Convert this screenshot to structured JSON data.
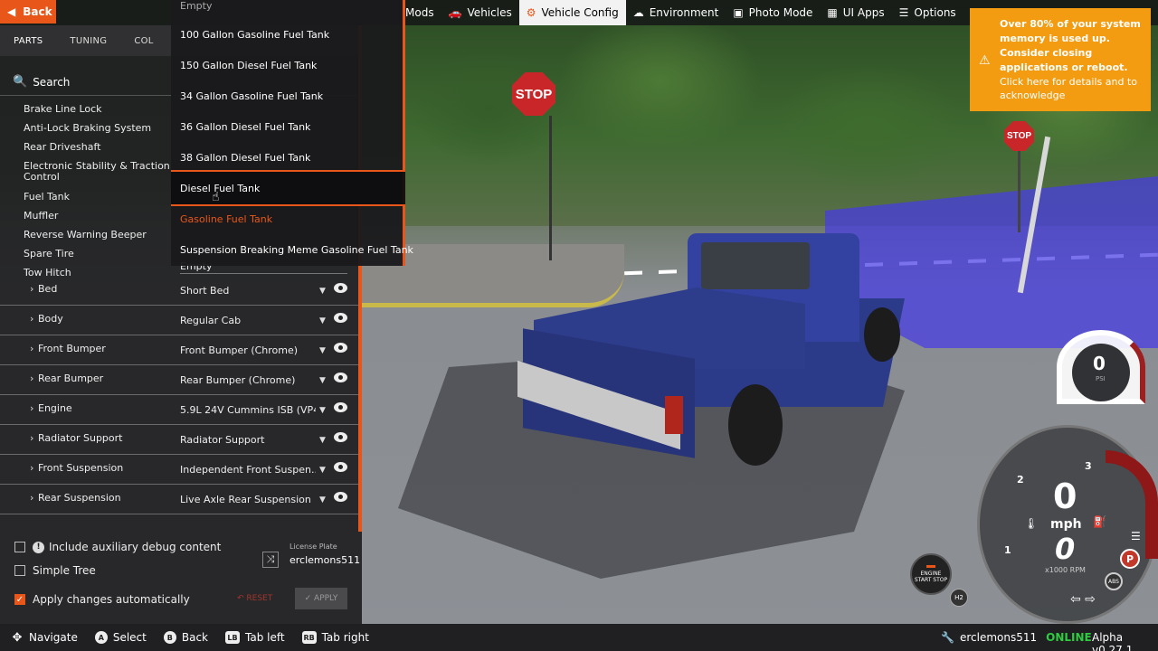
{
  "topbar": {
    "back_label": "Back",
    "tabs": [
      {
        "label": "Mods",
        "icon": "puzzle-icon"
      },
      {
        "label": "Vehicles",
        "icon": "car-icon"
      },
      {
        "label": "Vehicle Config",
        "icon": "engine-icon",
        "active": true
      },
      {
        "label": "Environment",
        "icon": "cloud-sun-icon"
      },
      {
        "label": "Photo Mode",
        "icon": "camera-icon"
      },
      {
        "label": "UI Apps",
        "icon": "apps-icon"
      },
      {
        "label": "Options",
        "icon": "sliders-icon"
      }
    ]
  },
  "panel": {
    "subtabs": [
      "PARTS",
      "TUNING",
      "COL"
    ],
    "search_placeholder": "Search",
    "slots": [
      "Brake Line Lock",
      "Anti-Lock Braking System",
      "Rear Driveshaft",
      "Electronic Stability & Traction Control",
      "Fuel Tank",
      "Muffler",
      "Reverse Warning Beeper",
      "Spare Tire",
      "Tow Hitch"
    ],
    "tow_hitch_value": "Empty",
    "rows": [
      {
        "label": "Bed",
        "value": "Short Bed"
      },
      {
        "label": "Body",
        "value": "Regular Cab"
      },
      {
        "label": "Front Bumper",
        "value": "Front Bumper (Chrome)"
      },
      {
        "label": "Rear Bumper",
        "value": "Rear Bumper (Chrome)"
      },
      {
        "label": "Engine",
        "value": "5.9L 24V Cummins ISB (VP44)"
      },
      {
        "label": "Radiator Support",
        "value": "Radiator Support"
      },
      {
        "label": "Front Suspension",
        "value": "Independent Front Suspen..."
      },
      {
        "label": "Rear Suspension",
        "value": "Live Axle Rear Suspension"
      }
    ],
    "debug_label": "Include auxiliary debug content",
    "simple_tree_label": "Simple Tree",
    "apply_auto_label": "Apply changes automatically",
    "license_plate_label": "License Plate",
    "license_plate_value": "erclemons511",
    "reset_label": "RESET",
    "apply_label": "APPLY"
  },
  "dropdown": {
    "items": [
      "Empty",
      "100 Gallon Gasoline Fuel Tank",
      "150 Gallon Diesel Fuel Tank",
      "34 Gallon Gasoline Fuel Tank",
      "36 Gallon Diesel Fuel Tank",
      "38 Gallon Diesel Fuel Tank",
      "Diesel Fuel Tank",
      "Gasoline Fuel Tank",
      "Suspension Breaking Meme Gasoline Fuel Tank"
    ],
    "hovered": "Diesel Fuel Tank",
    "selected": "Gasoline Fuel Tank"
  },
  "notification": {
    "bold_text": "Over 80% of your system memory is used up. Consider closing applications or reboot.",
    "normal_text": "Click here for details and to acknowledge"
  },
  "scene": {
    "stop_sign_text": "STOP"
  },
  "gauges": {
    "boost_value": "0",
    "boost_unit": "PSI",
    "speed_value": "0",
    "speed_unit": "mph",
    "rpm_value": "0",
    "rpm_unit": "x1000 RPM",
    "gear_marks": [
      "1",
      "2",
      "3"
    ],
    "park_label": "P",
    "abs_label": "ABS",
    "start_stop_label": "ENGINE START STOP",
    "h2_label": "H2"
  },
  "bottombar": {
    "hints": [
      {
        "key": "✥",
        "label": "Navigate"
      },
      {
        "key": "A",
        "label": "Select"
      },
      {
        "key": "B",
        "label": "Back"
      },
      {
        "key": "LB",
        "label": "Tab left"
      },
      {
        "key": "RB",
        "label": "Tab right"
      }
    ],
    "username": "erclemons511",
    "status": "ONLINE",
    "version": "Alpha v0.27.1"
  },
  "colors": {
    "accent": "#e8561a",
    "notification": "#f39c12",
    "online": "#2ecc40"
  }
}
